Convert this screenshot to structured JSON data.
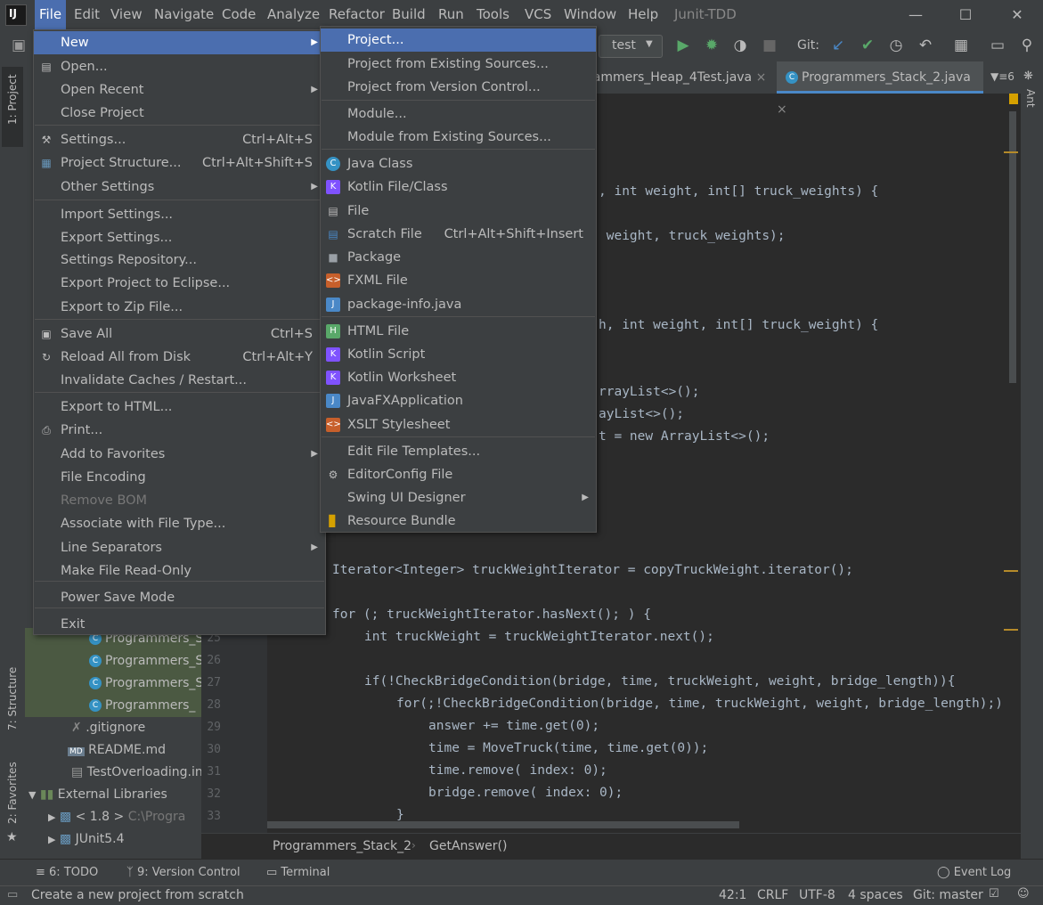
{
  "menubar": {
    "items": [
      "File",
      "Edit",
      "View",
      "Navigate",
      "Code",
      "Analyze",
      "Refactor",
      "Build",
      "Run",
      "Tools",
      "VCS",
      "Window",
      "Help"
    ],
    "project_name": "Junit-TDD"
  },
  "toolbar": {
    "run_config": "test",
    "git_label": "Git:"
  },
  "tabs": [
    "rammers_Heap_4Test.java",
    "Programmers_Stack_2.java"
  ],
  "tab_overflow": "6",
  "file_menu": [
    {
      "label": "New",
      "arrow": true
    },
    {
      "label": "Open..."
    },
    {
      "label": "Open Recent",
      "arrow": true
    },
    {
      "label": "Close Project"
    },
    {
      "label": "Settings...",
      "shortcut": "Ctrl+Alt+S"
    },
    {
      "label": "Project Structure...",
      "shortcut": "Ctrl+Alt+Shift+S"
    },
    {
      "label": "Other Settings",
      "arrow": true
    },
    {
      "label": "Import Settings..."
    },
    {
      "label": "Export Settings..."
    },
    {
      "label": "Settings Repository..."
    },
    {
      "label": "Export Project to Eclipse..."
    },
    {
      "label": "Export to Zip File..."
    },
    {
      "label": "Save All",
      "shortcut": "Ctrl+S"
    },
    {
      "label": "Reload All from Disk",
      "shortcut": "Ctrl+Alt+Y"
    },
    {
      "label": "Invalidate Caches / Restart..."
    },
    {
      "label": "Export to HTML..."
    },
    {
      "label": "Print..."
    },
    {
      "label": "Add to Favorites",
      "arrow": true
    },
    {
      "label": "File Encoding"
    },
    {
      "label": "Remove BOM"
    },
    {
      "label": "Associate with File Type..."
    },
    {
      "label": "Line Separators",
      "arrow": true
    },
    {
      "label": "Make File Read-Only"
    },
    {
      "label": "Power Save Mode"
    },
    {
      "label": "Exit"
    }
  ],
  "new_menu": [
    {
      "label": "Project..."
    },
    {
      "label": "Project from Existing Sources..."
    },
    {
      "label": "Project from Version Control..."
    },
    {
      "label": "Module..."
    },
    {
      "label": "Module from Existing Sources..."
    },
    {
      "label": "Java Class"
    },
    {
      "label": "Kotlin File/Class"
    },
    {
      "label": "File"
    },
    {
      "label": "Scratch File",
      "shortcut": "Ctrl+Alt+Shift+Insert"
    },
    {
      "label": "Package"
    },
    {
      "label": "FXML File"
    },
    {
      "label": "package-info.java"
    },
    {
      "label": "HTML File"
    },
    {
      "label": "Kotlin Script"
    },
    {
      "label": "Kotlin Worksheet"
    },
    {
      "label": "JavaFXApplication"
    },
    {
      "label": "XSLT Stylesheet"
    },
    {
      "label": "Edit File Templates..."
    },
    {
      "label": "EditorConfig File"
    },
    {
      "label": "Swing UI Designer",
      "arrow": true
    },
    {
      "label": "Resource Bundle"
    }
  ],
  "project_tree": [
    "Programmers_S",
    "Programmers_S",
    "Programmers_S",
    "Programmers_",
    ".gitignore",
    "README.md",
    "TestOverloading.in",
    "External Libraries",
    "< 1.8 >",
    "C:\\Progra",
    "JUnit5.4"
  ],
  "line_numbers": [
    "25",
    "26",
    "27",
    "28",
    "29",
    "30",
    "31",
    "32",
    "33"
  ],
  "code": {
    "l1": ", int weight, int[] truck_weights) {",
    "l2": " weight, truck_weights);",
    "l3": "h, int weight, int[] truck_weight) {",
    "l4": "rrayList<>();",
    "l5": "ayList<>();",
    "l6": "t = new ArrayList<>();",
    "l7": "Iterator<Integer> truckWeightIterator = copyTruckWeight.iterator();",
    "l8": "for (; truckWeightIterator.hasNext(); ) {",
    "l9": "int truckWeight = truckWeightIterator.next();",
    "l10": "if(!CheckBridgeCondition(bridge, time, truckWeight, weight, bridge_length)){",
    "l11": "for(;!CheckBridgeCondition(bridge, time, truckWeight, weight, bridge_length);)",
    "l12": "answer += time.get(0);",
    "l13": "time = MoveTruck(time, time.get(0));",
    "l14": "time.remove( index: 0);",
    "l15": "bridge.remove( index: 0);",
    "l16": "}"
  },
  "breadcrumb": [
    "Programmers_Stack_2",
    "GetAnswer()"
  ],
  "tool_windows": {
    "todo": "6: TODO",
    "vcs": "9: Version Control",
    "terminal": "Terminal",
    "event_log": "Event Log"
  },
  "side_tabs": {
    "project": "1: Project",
    "structure": "7: Structure",
    "favorites": "2: Favorites",
    "ant": "Ant"
  },
  "status": {
    "message": "Create a new project from scratch",
    "position": "42:1",
    "line_sep": "CRLF",
    "encoding": "UTF-8",
    "indent": "4 spaces",
    "git": "Git: master"
  },
  "colors": {
    "accent": "#4b6eaf",
    "background": "#2b2b2b",
    "panel": "#3c3f41",
    "keyword": "#cc7832",
    "number": "#6897bb"
  }
}
